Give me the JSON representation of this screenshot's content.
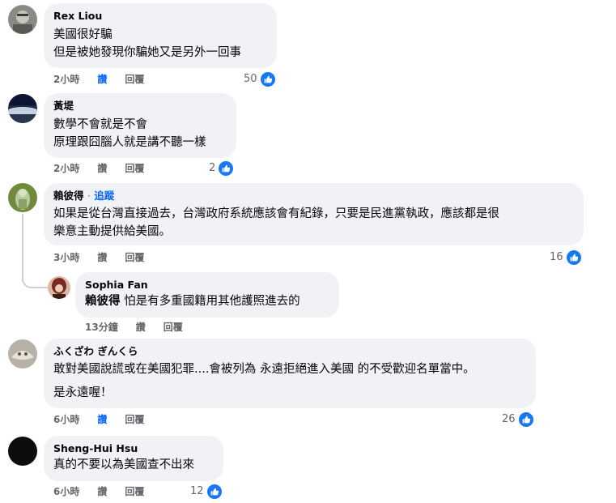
{
  "actions": {
    "like": "讚",
    "reply": "回覆"
  },
  "comments": [
    {
      "author": "Rex Liou",
      "lines": [
        "美國很好騙",
        "但是被她發現你騙她又是另外一回事"
      ],
      "time": "2小時",
      "likes": "50"
    },
    {
      "author": "黃堤",
      "lines": [
        "數學不會就是不會",
        "原理跟囧腦人就是講不聽一樣"
      ],
      "time": "2小時",
      "likes": "2"
    },
    {
      "author": "賴彼得",
      "follow": "追蹤",
      "lines": [
        "如果是從台灣直接過去，台灣政府系統應該會有紀錄，只要是民進黨執政，應該都是很",
        "樂意主動提供給美國。"
      ],
      "time": "3小時",
      "likes": "16"
    },
    {
      "author": "Sophia Fan",
      "mention": "賴彼得",
      "lines": [
        "怕是有多重國籍用其他護照進去的"
      ],
      "time": "13分鐘"
    },
    {
      "author": "ふくざわ ぎんくら",
      "lines": [
        "敢對美國說謊或在美國犯罪....會被列為 永遠拒絕進入美國 的不受歡迎名單當中。",
        "是永遠喔！"
      ],
      "time": "6小時",
      "likes": "26"
    },
    {
      "author": "Sheng-Hui Hsu",
      "lines": [
        "真的不要以為美國查不出來"
      ],
      "time": "6小時",
      "likes": "12"
    }
  ],
  "colors": {
    "like_blue": "#1877f2",
    "bubble_bg": "#f0f2f5",
    "meta_grey": "#65676b"
  }
}
